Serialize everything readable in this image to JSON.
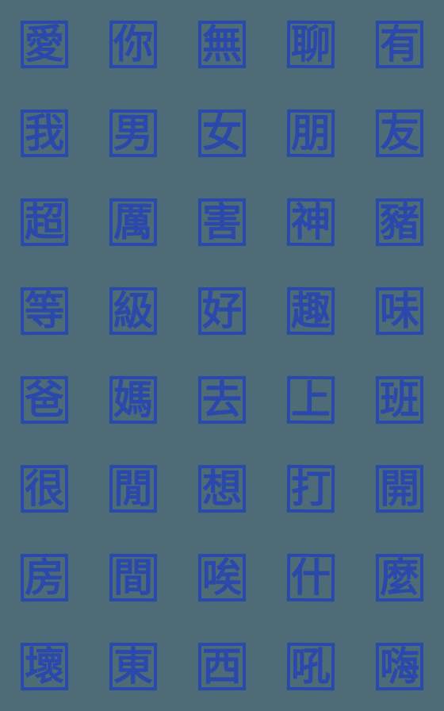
{
  "sheet": {
    "title": "Handwritten Chinese Character Sticker Sheet",
    "background_color": "#4e6b78",
    "ink_color": "#2b49ab",
    "columns": 5,
    "rows": 8,
    "cell_size_px": 112,
    "stamp_size_px": 60,
    "glyph_count": 40
  },
  "rows": [
    {
      "index": 1,
      "phrase": "愛你無聊有",
      "cells": [
        {
          "char": "愛",
          "name": "glyph-ai-love"
        },
        {
          "char": "你",
          "name": "glyph-ni-you"
        },
        {
          "char": "無",
          "name": "glyph-wu-none"
        },
        {
          "char": "聊",
          "name": "glyph-liao-chat"
        },
        {
          "char": "有",
          "name": "glyph-you-have"
        }
      ]
    },
    {
      "index": 2,
      "phrase": "我男女朋友",
      "cells": [
        {
          "char": "我",
          "name": "glyph-wo-i"
        },
        {
          "char": "男",
          "name": "glyph-nan-male"
        },
        {
          "char": "女",
          "name": "glyph-nv-female"
        },
        {
          "char": "朋",
          "name": "glyph-peng-friend"
        },
        {
          "char": "友",
          "name": "glyph-you-friend"
        }
      ]
    },
    {
      "index": 3,
      "phrase": "超厲害神豬",
      "cells": [
        {
          "char": "超",
          "name": "glyph-chao-super"
        },
        {
          "char": "厲",
          "name": "glyph-li-severe"
        },
        {
          "char": "害",
          "name": "glyph-hai-harm"
        },
        {
          "char": "神",
          "name": "glyph-shen-god"
        },
        {
          "char": "豬",
          "name": "glyph-zhu-pig"
        }
      ]
    },
    {
      "index": 4,
      "phrase": "等級好趣味",
      "cells": [
        {
          "char": "等",
          "name": "glyph-deng-rank"
        },
        {
          "char": "級",
          "name": "glyph-ji-level"
        },
        {
          "char": "好",
          "name": "glyph-hao-good"
        },
        {
          "char": "趣",
          "name": "glyph-qu-interest"
        },
        {
          "char": "味",
          "name": "glyph-wei-taste"
        }
      ]
    },
    {
      "index": 5,
      "phrase": "爸媽去上班",
      "cells": [
        {
          "char": "爸",
          "name": "glyph-ba-dad"
        },
        {
          "char": "媽",
          "name": "glyph-ma-mom"
        },
        {
          "char": "去",
          "name": "glyph-qu-go"
        },
        {
          "char": "上",
          "name": "glyph-shang-up"
        },
        {
          "char": "班",
          "name": "glyph-ban-work"
        }
      ]
    },
    {
      "index": 6,
      "phrase": "很閒想打開",
      "cells": [
        {
          "char": "很",
          "name": "glyph-hen-very"
        },
        {
          "char": "閒",
          "name": "glyph-xian-idle"
        },
        {
          "char": "想",
          "name": "glyph-xiang-think"
        },
        {
          "char": "打",
          "name": "glyph-da-hit"
        },
        {
          "char": "開",
          "name": "glyph-kai-open"
        }
      ]
    },
    {
      "index": 7,
      "phrase": "房間唉什麼",
      "cells": [
        {
          "char": "房",
          "name": "glyph-fang-room"
        },
        {
          "char": "間",
          "name": "glyph-jian-room"
        },
        {
          "char": "唉",
          "name": "glyph-ai-sigh"
        },
        {
          "char": "什",
          "name": "glyph-shi-what"
        },
        {
          "char": "麼",
          "name": "glyph-me-what"
        }
      ]
    },
    {
      "index": 8,
      "phrase": "壞東西吼嗨",
      "cells": [
        {
          "char": "壞",
          "name": "glyph-huai-bad"
        },
        {
          "char": "東",
          "name": "glyph-dong-east"
        },
        {
          "char": "西",
          "name": "glyph-xi-west"
        },
        {
          "char": "吼",
          "name": "glyph-hou-roar"
        },
        {
          "char": "嗨",
          "name": "glyph-hai-hi"
        }
      ]
    }
  ]
}
